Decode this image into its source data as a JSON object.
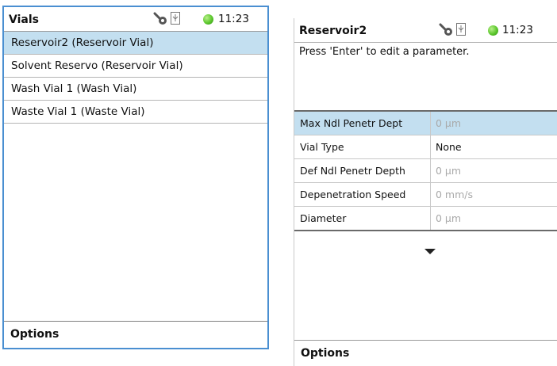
{
  "left": {
    "title": "Vials",
    "time": "11:23",
    "items": [
      {
        "label": "Reservoir2 (Reservoir Vial)"
      },
      {
        "label": "Solvent Reservo (Reservoir Vial)"
      },
      {
        "label": "Wash Vial 1 (Wash Vial)"
      },
      {
        "label": "Waste Vial 1 (Waste Vial)"
      }
    ],
    "options_label": "Options"
  },
  "right": {
    "title": "Reservoir2",
    "time": "11:23",
    "message": "Press 'Enter' to edit a parameter.",
    "params": [
      {
        "name": "Max Ndl Penetr Dept",
        "value": "0 μm"
      },
      {
        "name": "Vial Type",
        "value": "None"
      },
      {
        "name": "Def Ndl Penetr Depth",
        "value": "0 μm"
      },
      {
        "name": "Depenetration Speed",
        "value": "0 mm/s"
      },
      {
        "name": "Diameter",
        "value": "0 μm"
      }
    ],
    "options_label": "Options"
  },
  "icons": {
    "wrench": "wrench-icon",
    "usb": "usb-icon",
    "status": "status-green-dot-icon"
  },
  "colors": {
    "selection": "#c3dff0",
    "frame": "#4a8fd1",
    "status_green": "#5cc72d"
  }
}
